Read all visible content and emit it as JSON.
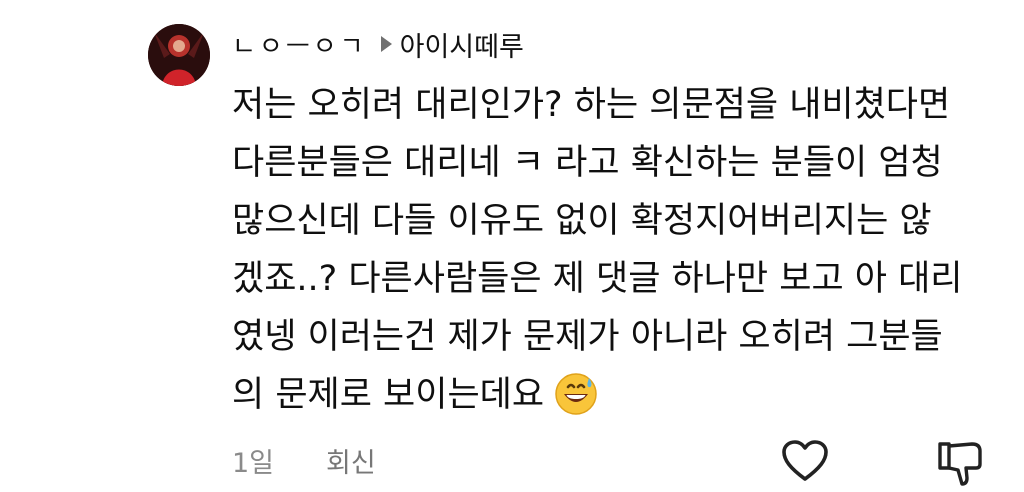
{
  "comment": {
    "author": "ㄴㅇㅡㅇㄱ",
    "reply_to": "아이시떼루",
    "lines": [
      "저는 오히려 대리인가? 하는 의문점을 내비쳤다면",
      "다른분들은 대리네 ㅋ 라고 확신하는 분들이 엄청",
      "많으신데 다들 이유도 없이 확정지어버리지는 않",
      "겠죠..? 다른사람들은 제 댓글 하나만 보고 아 대리",
      "였넹 이러는건 제가 문제가 아니라 오히려 그분들",
      "의 문제로 보이는데요"
    ],
    "emoji_icon": "grinning-face-with-sweat-icon",
    "time": "1일",
    "reply_label": "회신"
  },
  "icons": {
    "like": "heart-outline-icon",
    "dislike": "thumbs-down-outline-icon",
    "reply_indicator": "triangle-right-icon"
  },
  "colors": {
    "text": "#0f0f0f",
    "meta": "#8a8a8a",
    "icon": "#222222"
  }
}
